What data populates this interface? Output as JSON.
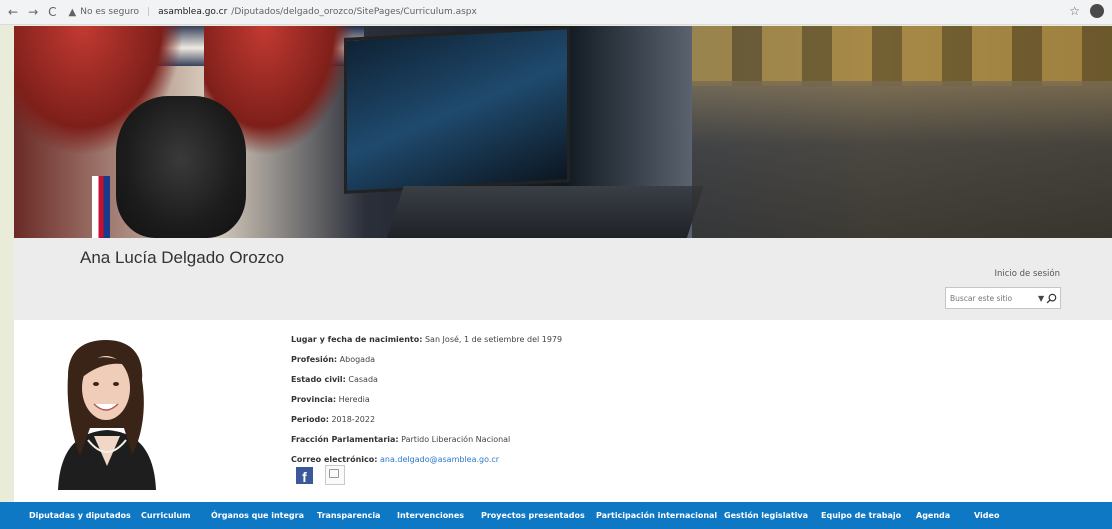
{
  "browser": {
    "warning": "No es seguro",
    "domain": "asamblea.go.cr",
    "path": "/Diputados/delgado_orozco/SitePages/Curriculum.aspx"
  },
  "header": {
    "title": "Ana Lucía Delgado Orozco",
    "signin": "Inicio de sesión",
    "search_placeholder": "Buscar este sitio"
  },
  "profile": {
    "birth_label": "Lugar y fecha de nacimiento:",
    "birth_value": " San José, 1 de setiembre del 1979",
    "profession_label": "Profesión:",
    "profession_value": " Abogada",
    "civil_label": "Estado civil:",
    "civil_value": " Casada",
    "province_label": "Provincia:",
    "province_value": " Heredia",
    "period_label": "Periodo:",
    "period_value": " 2018-2022",
    "fraction_label": "Fracción Parlamentaria:",
    "fraction_value": " Partido Liberación Nacional",
    "email_label": "Correo electrónico:",
    "email_value": "ana.delgado@asamblea.go.cr"
  },
  "nav": [
    "Diputadas y diputados",
    "Curriculum",
    "Órganos que integra",
    "Transparencia",
    "Intervenciones",
    "Proyectos presentados",
    "Participación internacional",
    "Gestión legislativa",
    "Equipo de trabajo",
    "Agenda",
    "Video"
  ],
  "colors": {
    "nav_bg": "#0e78c5",
    "link": "#2a7ac8"
  }
}
